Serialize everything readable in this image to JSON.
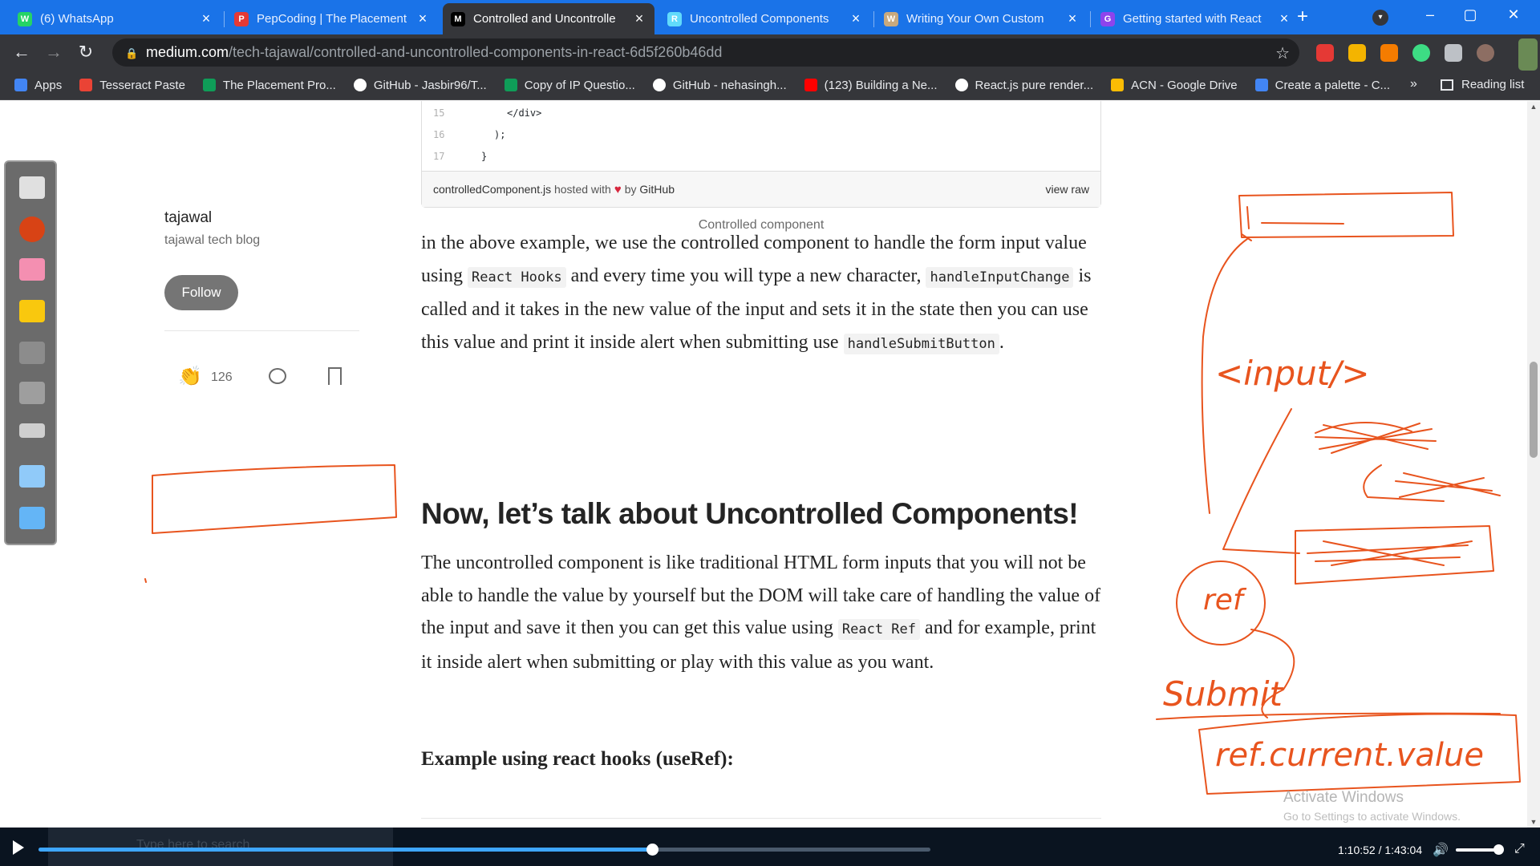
{
  "browser": {
    "tabs": [
      {
        "title": "(6) WhatsApp",
        "color": "#25d366",
        "glyph": "W"
      },
      {
        "title": "PepCoding | The Placement",
        "color": "#e53935",
        "glyph": "P"
      },
      {
        "title": "Controlled and Uncontrolle",
        "color": "#000000",
        "glyph": "M"
      },
      {
        "title": "Uncontrolled Components",
        "color": "#61dafb",
        "glyph": "R"
      },
      {
        "title": "Writing Your Own Custom",
        "color": "#c8a97e",
        "glyph": "W"
      },
      {
        "title": "Getting started with React",
        "color": "#8e44ec",
        "glyph": "G"
      }
    ],
    "close_glyph": "×",
    "new_tab_glyph": "+",
    "url_host": "medium.com",
    "url_path": "/tech-tajawal/controlled-and-uncontrolled-components-in-react-6d5f260b46dd",
    "bookmarks": [
      {
        "label": "Apps",
        "color": "#4285f4"
      },
      {
        "label": "Tesseract Paste",
        "color": "#ea4335"
      },
      {
        "label": "The Placement Pro...",
        "color": "#0f9d58"
      },
      {
        "label": "GitHub - Jasbir96/T...",
        "color": "#ffffff"
      },
      {
        "label": "Copy of IP Questio...",
        "color": "#0f9d58"
      },
      {
        "label": "GitHub - nehasingh...",
        "color": "#ffffff"
      },
      {
        "label": "(123) Building a Ne...",
        "color": "#ff0000"
      },
      {
        "label": "React.js pure render...",
        "color": "#ffffff"
      },
      {
        "label": "ACN - Google Drive",
        "color": "#fbbc04"
      },
      {
        "label": "Create a palette - C...",
        "color": "#4285f4"
      }
    ],
    "bookmarks_more": "»",
    "reading_list": "Reading list"
  },
  "gist": {
    "lines": [
      {
        "num": "15",
        "code": "</div>",
        "indent": 7
      },
      {
        "num": "16",
        "code": ");",
        "indent": 5
      },
      {
        "num": "17",
        "code": "}",
        "indent": 3
      }
    ],
    "filename": "controlledComponent.js",
    "hosted_with": "hosted with",
    "by": "by",
    "github": "GitHub",
    "view_raw": "view raw"
  },
  "caption": "Controlled component",
  "article": {
    "p1": {
      "a": "in the above example, we use the controlled component to handle the form input value using ",
      "code1": "React Hooks",
      "b": " and every time you will type a new character, ",
      "code2": "handleInputChange",
      "c": " is called and it takes in the new value of the input and sets it in the state then you can use this value and print it inside alert when submitting use ",
      "code3": "handleSubmitButton",
      "d": "."
    },
    "heading": "Now, let’s talk about Uncontrolled Components!",
    "p2": {
      "a": "The uncontrolled component is like traditional HTML form inputs that you will not be able to handle the value by yourself but the DOM will take care of handling the value of the input and save it then you can get this value using ",
      "code1": "React Ref",
      "b": " and for example, print it inside alert when submitting or play with this value as you want."
    },
    "subheading": "Example using react hooks (useRef):"
  },
  "author": {
    "name": "tajawal",
    "blog": "tajawal tech blog",
    "follow": "Follow",
    "claps": "126"
  },
  "ink": {
    "color": "#e8541e",
    "input_label": "<input/>",
    "ref_label": "ref",
    "submit_label": "Submit",
    "value_label": "ref.current.value"
  },
  "watermark": {
    "title": "Activate Windows",
    "subtitle": "Go to Settings to activate Windows."
  },
  "player": {
    "search_hint": "Type here to search",
    "time_current": "1:10:52",
    "time_total": "1:43:04",
    "time_sep": " / ",
    "progress_fraction": 0.688,
    "volume_fraction": 0.85
  }
}
